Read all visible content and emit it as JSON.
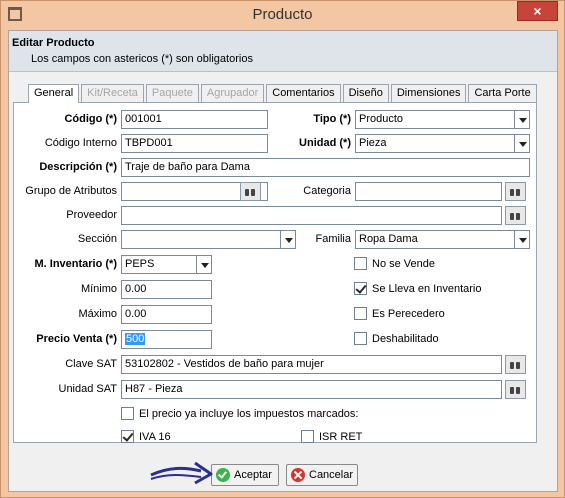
{
  "window": {
    "title": "Producto",
    "close_glyph": "×"
  },
  "header": {
    "title": "Editar Producto",
    "subtitle": "Los campos con astericos (*) son obligatorios"
  },
  "tabs": [
    {
      "label": "General",
      "state": "active"
    },
    {
      "label": "Kit/Receta",
      "state": "disabled"
    },
    {
      "label": "Paquete",
      "state": "disabled"
    },
    {
      "label": "Agrupador",
      "state": "disabled"
    },
    {
      "label": "Comentarios",
      "state": "normal"
    },
    {
      "label": "Diseño",
      "state": "normal"
    },
    {
      "label": "Dimensiones",
      "state": "normal"
    },
    {
      "label": "Carta Porte",
      "state": "normal"
    }
  ],
  "form": {
    "codigo": {
      "label": "Código (*)",
      "value": "001001"
    },
    "tipo": {
      "label": "Tipo (*)",
      "value": "Producto"
    },
    "codigo_interno": {
      "label": "Código Interno",
      "value": "TBPD001"
    },
    "unidad": {
      "label": "Unidad (*)",
      "value": "Pieza"
    },
    "descripcion": {
      "label": "Descripción (*)",
      "value": "Traje de baño para Dama"
    },
    "grupo_atributos": {
      "label": "Grupo de Atributos",
      "value": ""
    },
    "categoria": {
      "label": "Categoria",
      "value": ""
    },
    "proveedor": {
      "label": "Proveedor",
      "value": ""
    },
    "seccion": {
      "label": "Sección",
      "value": ""
    },
    "familia": {
      "label": "Familia",
      "value": "Ropa Dama"
    },
    "m_inventario": {
      "label": "M. Inventario (*)",
      "value": "PEPS"
    },
    "minimo": {
      "label": "Mínimo",
      "value": "0.00"
    },
    "maximo": {
      "label": "Máximo",
      "value": "0.00"
    },
    "precio_venta": {
      "label": "Precio Venta (*)",
      "value": "500"
    },
    "clave_sat": {
      "label": "Clave SAT",
      "value": "53102802 - Vestidos de baño para mujer"
    },
    "unidad_sat": {
      "label": "Unidad SAT",
      "value": "H87 - Pieza"
    }
  },
  "checkboxes": {
    "no_se_vende": {
      "label": "No se Vende",
      "checked": false
    },
    "se_lleva_inventario": {
      "label": "Se Lleva en Inventario",
      "checked": true
    },
    "es_perecedero": {
      "label": "Es Perecedero",
      "checked": false
    },
    "deshabilitado": {
      "label": "Deshabilitado",
      "checked": false
    },
    "precio_incluye": {
      "label": "El precio ya incluye los impuestos marcados:",
      "checked": false
    },
    "iva16": {
      "label": "IVA 16",
      "checked": true
    },
    "isr_ret": {
      "label": "ISR RET",
      "checked": false
    }
  },
  "buttons": {
    "accept": "Aceptar",
    "cancel": "Cancelar"
  },
  "icons": {
    "app": "window-icon",
    "lookup": "binoculars-icon",
    "accept": "check-circle-icon",
    "cancel": "x-circle-icon",
    "annotation": "arrow-right-icon"
  },
  "colors": {
    "window_frame": "#f3c7a4",
    "close_button": "#c7443a",
    "header_bg": "#dfe4ea",
    "selection": "#3399ff",
    "annotation_arrow": "#2c2f8f"
  }
}
